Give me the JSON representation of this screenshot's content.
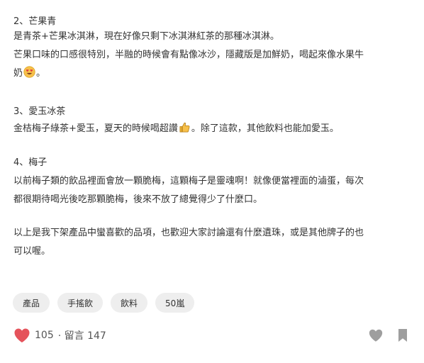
{
  "sections": {
    "mango": {
      "heading": "2、芒果青",
      "line1": "是青茶+芒果冰淇淋，現在好像只剩下冰淇淋紅茶的那種冰淇淋。",
      "line2": "芒果口味的口感很特別，半融的時候會有點像冰沙，隱藏版是加鮮奶，喝起來像水果牛",
      "line3a": "奶",
      "line3b": "。",
      "emoji_icon": "smiling-face-heart-eyes-icon"
    },
    "aiyu": {
      "heading": "3、愛玉冰茶",
      "line1a": "金桔梅子綠茶+愛玉，夏天的時候喝超讚",
      "line1b": "。除了這款，其他飲料也能加愛玉。",
      "emoji_icon": "thumbs-up-icon"
    },
    "plum": {
      "heading": "4、梅子",
      "line1": "以前梅子類的飲品裡面會放一顆脆梅，這顆梅子是靈魂啊！就像便當裡面的滷蛋，每次",
      "line2": "都很期待喝光後吃那顆脆梅，後來不放了總覺得少了什麼口。"
    },
    "closing": {
      "line1": "以上是我下架產品中蠻喜歡的品項，也歡迎大家討論還有什麼遺珠，或是其他牌子的也",
      "line2": "可以喔。"
    }
  },
  "tags": [
    "產品",
    "手搖飲",
    "飲料",
    "50嵐"
  ],
  "footer": {
    "like_count": "105",
    "comment_text": "· 留言 147",
    "like_icon": "heart-icon",
    "save_icon": "bookmark-icon"
  },
  "colors": {
    "heart_red": "#e5535b",
    "icon_gray": "#9e9e9e",
    "tag_bg": "#eeeeee"
  }
}
